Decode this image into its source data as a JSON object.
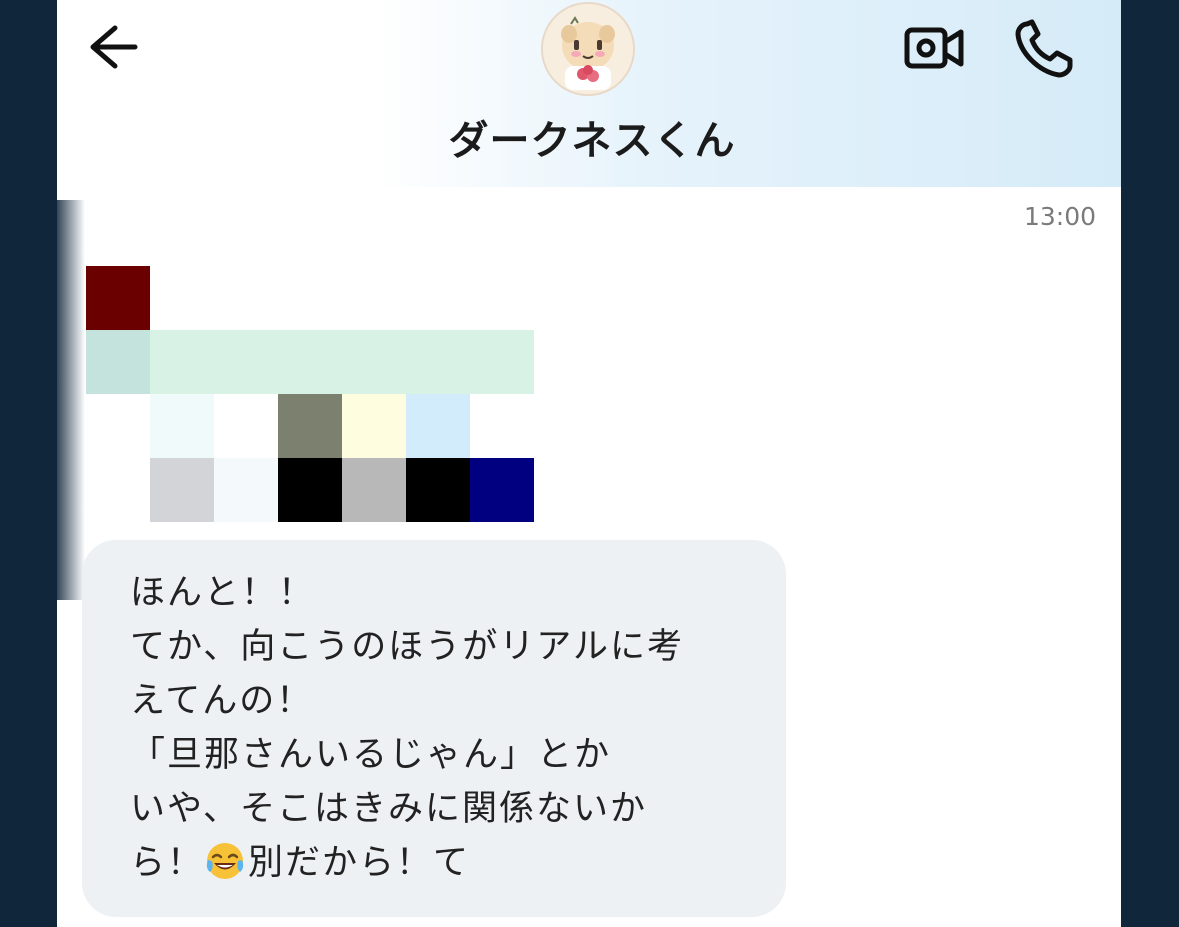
{
  "header": {
    "contact_name": "ダークネスくん",
    "icons": [
      "back-arrow-icon",
      "video-call-icon",
      "phone-icon"
    ],
    "background_gradient": [
      "#ffffff",
      "#d5ebf8"
    ]
  },
  "chat": {
    "timestamp": "13:00",
    "redacted_mosaic_colors": [
      [
        "#6b0000"
      ],
      [
        "#c3e3dc",
        "#d8f3e6",
        "#d8f3e6",
        "#d8f3e6",
        "#d8f3e6",
        "#d8f3e6",
        "#d8f3e6"
      ],
      [
        "#ffffff",
        "#f1fafb",
        "#ffffff",
        "#7b806f",
        "#fffde0",
        "#d2ecfb",
        "#ffffff"
      ],
      [
        "#ffffff",
        "#d3d4d8",
        "#f4f9fc",
        "#000000",
        "#b8b8b8",
        "#000000",
        "#000080"
      ]
    ],
    "message": {
      "lines": [
        "ほんと！！",
        "てか、向こうのほうがリアルに考",
        "えてんの！",
        "「旦那さんいるじゃん」とか",
        "いや、そこはきみに関係ないか",
        "ら！",
        "別だから！て"
      ],
      "emoji": "face-with-tears-of-joy-icon",
      "bubble_color": "#edf1f3"
    }
  },
  "colors": {
    "frame": "#10263a",
    "screen": "#ffffff",
    "text": "#222222",
    "timestamp": "#7a7a7a"
  }
}
